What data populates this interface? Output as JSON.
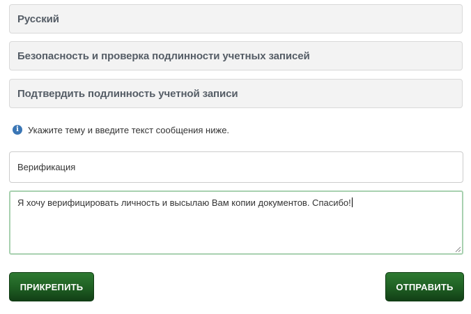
{
  "form": {
    "language": "Русский",
    "category": "Безопасность и проверка подлинности учетных записей",
    "topic": "Подтвердить подлинность учетной записи",
    "info_text": "Укажите тему и введите текст сообщения ниже.",
    "subject_value": "Верификация",
    "message_value": "Я хочу верифицировать личность и высылаю Вам копии документов. Спасибо!",
    "attach_label": "ПРИКРЕПИТЬ",
    "send_label": "ОТПРАВИТЬ"
  },
  "icons": {
    "info": "info-icon",
    "resize": "resize-grip-icon"
  },
  "colors": {
    "button_green": "#1e5e22",
    "info_blue": "#3a76b5",
    "textarea_focus_border": "#a8d1b0"
  }
}
